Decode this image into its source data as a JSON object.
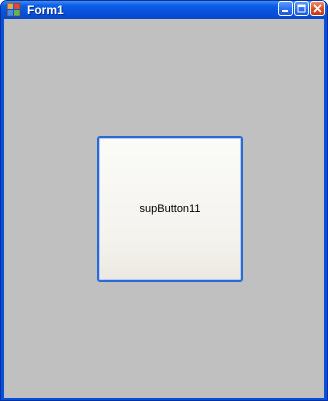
{
  "window": {
    "title": "Form1",
    "icon": "form-app-icon"
  },
  "caption_buttons": {
    "minimize": "minimize-icon",
    "maximize": "maximize-icon",
    "close": "close-icon"
  },
  "client": {
    "background": "#c0c0c0",
    "sup_button": {
      "label": "supButton11"
    }
  },
  "colors": {
    "titlebar": "#0b5fe8",
    "frame": "#0a4fd9",
    "close_button": "#dc4a21",
    "button_border": "#2a6ad6"
  }
}
